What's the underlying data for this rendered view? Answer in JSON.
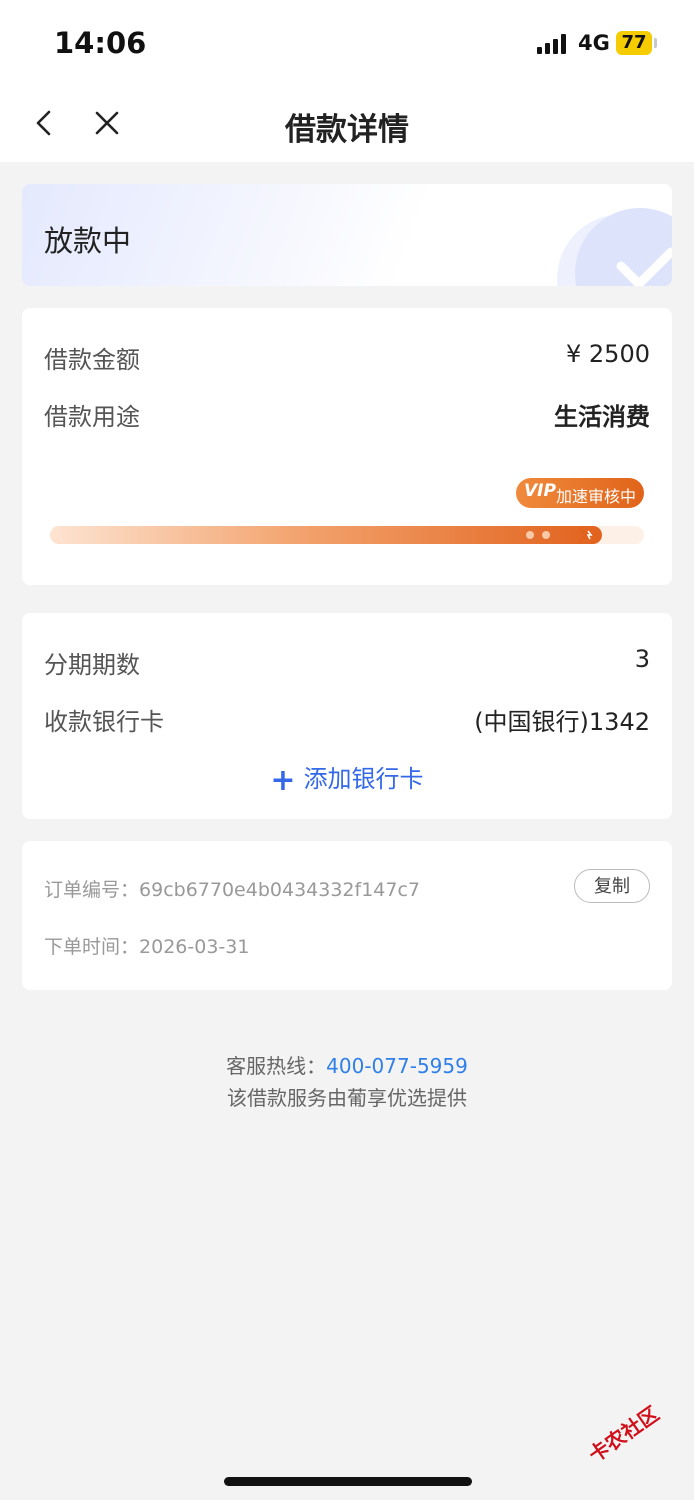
{
  "status_bar": {
    "time": "14:06",
    "network": "4G",
    "battery": "77"
  },
  "nav": {
    "title": "借款详情"
  },
  "loan_status": {
    "text": "放款中"
  },
  "loan": {
    "amount_label": "借款金额",
    "amount_value": "¥ 2500",
    "purpose_label": "借款用途",
    "purpose_value": "生活消费",
    "vip_badge": "VIP",
    "vip_text": "加速审核中",
    "progress": 0.93
  },
  "installment": {
    "periods_label": "分期期数",
    "periods_value": "3",
    "bank_label": "收款银行卡",
    "bank_value": "(中国银行)1342",
    "add_bank_label": "添加银行卡"
  },
  "order": {
    "number_label": "订单编号：",
    "number_value": "69cb6770e4b0434332f147c7",
    "copy_label": "复制",
    "time_label": "下单时间：",
    "time_value": "2026-03-31"
  },
  "footer": {
    "hotline_label": "客服热线：",
    "hotline_value": "400-077-5959",
    "provider_text": "该借款服务由葡享优选提供"
  },
  "watermark": "卡农社区",
  "colors": {
    "accent": "#3468e8",
    "progress": "#e1621d",
    "link": "#2f80e8"
  }
}
